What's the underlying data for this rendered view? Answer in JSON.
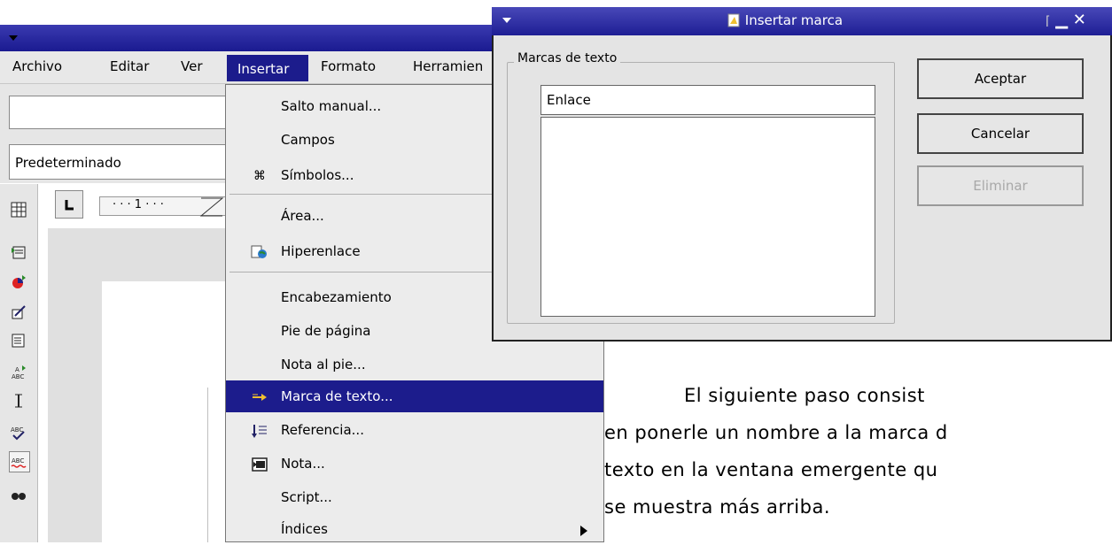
{
  "menubar": {
    "items": [
      {
        "label": "Archivo",
        "underline": "A"
      },
      {
        "label": "Editar",
        "underline": "E"
      },
      {
        "label": "Ver",
        "underline": "V"
      },
      {
        "label": "Insertar",
        "underline": "I"
      },
      {
        "label": "Formato",
        "underline": "F"
      },
      {
        "label": "Herramien",
        "underline": "H"
      }
    ]
  },
  "toolbar": {
    "style_value": "Predeterminado",
    "font_value": ""
  },
  "ruler": {
    "text": "· · · 1 · · ·"
  },
  "insert_menu": {
    "items": [
      {
        "label": "Salto manual...",
        "icon": ""
      },
      {
        "label": "Campos",
        "icon": ""
      },
      {
        "label": "Símbolos...",
        "icon": "command-symbol-icon"
      },
      {
        "label": "Área...",
        "icon": ""
      },
      {
        "label": "Hiperenlace",
        "icon": "hyperlink-globe-icon"
      },
      {
        "label": "Encabezamiento",
        "icon": ""
      },
      {
        "label": "Pie de página",
        "icon": ""
      },
      {
        "label": "Nota al pie...",
        "icon": ""
      },
      {
        "label": "Marca de texto...",
        "icon": "bookmark-arrow-icon"
      },
      {
        "label": "Referencia...",
        "icon": "reference-icon"
      },
      {
        "label": "Nota...",
        "icon": "note-icon"
      },
      {
        "label": "Script...",
        "icon": ""
      },
      {
        "label": "Índices",
        "icon": "submenu-arrow"
      }
    ],
    "highlighted": "Marca de texto..."
  },
  "dialog": {
    "title": "Insertar marca",
    "group_label": "Marcas de texto",
    "name_value": "Enlace",
    "buttons": {
      "ok": "Aceptar",
      "cancel": "Cancelar",
      "delete": "Eliminar"
    },
    "colors": {
      "title_bar": "#1e1e94",
      "highlight": "#1c1c8c"
    }
  },
  "document": {
    "lines": [
      "El siguiente paso consist",
      "en ponerle un nombre a la marca d",
      "texto en la ventana emergente qu",
      "se muestra más arriba."
    ]
  }
}
